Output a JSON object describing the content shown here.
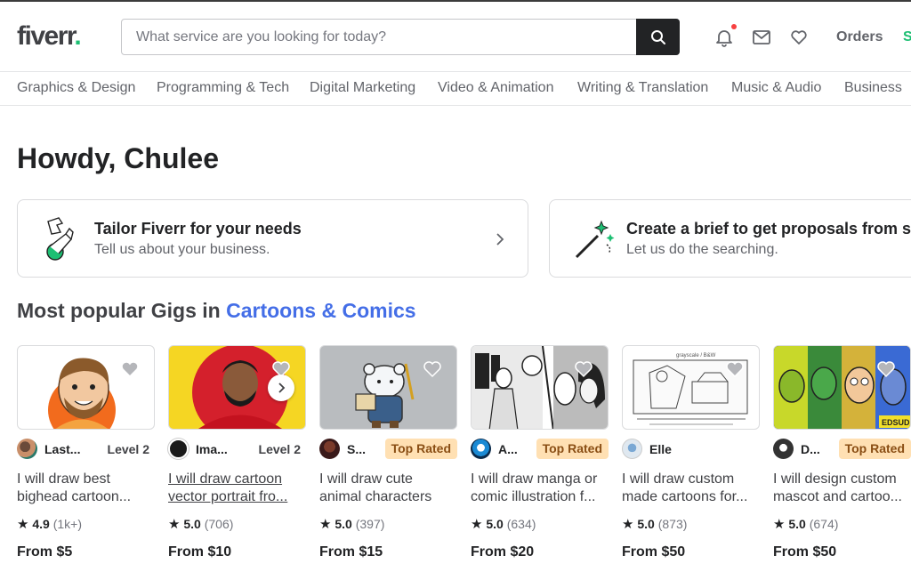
{
  "header": {
    "logo": "fiverr",
    "logo_dot": ".",
    "search_placeholder": "What service are you looking for today?",
    "orders_label": "Orders",
    "switch_label": "S",
    "icons": [
      "search-icon",
      "bell-icon",
      "mail-icon",
      "heart-icon"
    ],
    "colors": {
      "brand_green": "#1dbf73",
      "accent_blue": "#446ee7",
      "notification_red": "#f74040"
    }
  },
  "categories": [
    "Graphics & Design",
    "Programming & Tech",
    "Digital Marketing",
    "Video & Animation",
    "Writing & Translation",
    "Music & Audio",
    "Business"
  ],
  "greeting": "Howdy, Chulee",
  "promos": [
    {
      "title": "Tailor Fiverr for your needs",
      "subtitle": "Tell us about your business.",
      "icon": "puzzle-icon"
    },
    {
      "title": "Create a brief to get proposals from s",
      "subtitle": "Let us do the searching.",
      "icon": "magic-wand-icon"
    }
  ],
  "section": {
    "prefix": "Most popular Gigs in ",
    "category": "Cartoons & Comics"
  },
  "gigs": [
    {
      "seller": "Last...",
      "badge": "Level 2",
      "badge_type": "level",
      "title_line1": "I will draw best",
      "title_line2": "bighead cartoon...",
      "rating": "4.9",
      "reviews": "(1k+)",
      "price": "From $5"
    },
    {
      "seller": "Ima...",
      "badge": "Level 2",
      "badge_type": "level",
      "title_line1": "I will draw cartoon",
      "title_line2": "vector portrait fro...",
      "rating": "5.0",
      "reviews": "(706)",
      "price": "From $10"
    },
    {
      "seller": "S...",
      "badge": "Top Rated",
      "badge_type": "top",
      "title_line1": "I will draw cute",
      "title_line2": "animal characters",
      "rating": "5.0",
      "reviews": "(397)",
      "price": "From $15"
    },
    {
      "seller": "A...",
      "badge": "Top Rated",
      "badge_type": "top",
      "title_line1": "I will draw manga or",
      "title_line2": "comic illustration f...",
      "rating": "5.0",
      "reviews": "(634)",
      "price": "From $20"
    },
    {
      "seller": "Elle",
      "badge": "",
      "badge_type": "none",
      "title_line1": "I will draw custom",
      "title_line2": "made cartoons for...",
      "rating": "5.0",
      "reviews": "(873)",
      "price": "From $50"
    },
    {
      "seller": "D...",
      "badge": "Top Rated",
      "badge_type": "top",
      "title_line1": "I will design custom",
      "title_line2": "mascot and cartoo...",
      "rating": "5.0",
      "reviews": "(674)",
      "price": "From $50"
    }
  ],
  "gig_thumb_text": {
    "gig5_caption": "grayscale / B&W",
    "gig6_tag": "EDSUD"
  }
}
